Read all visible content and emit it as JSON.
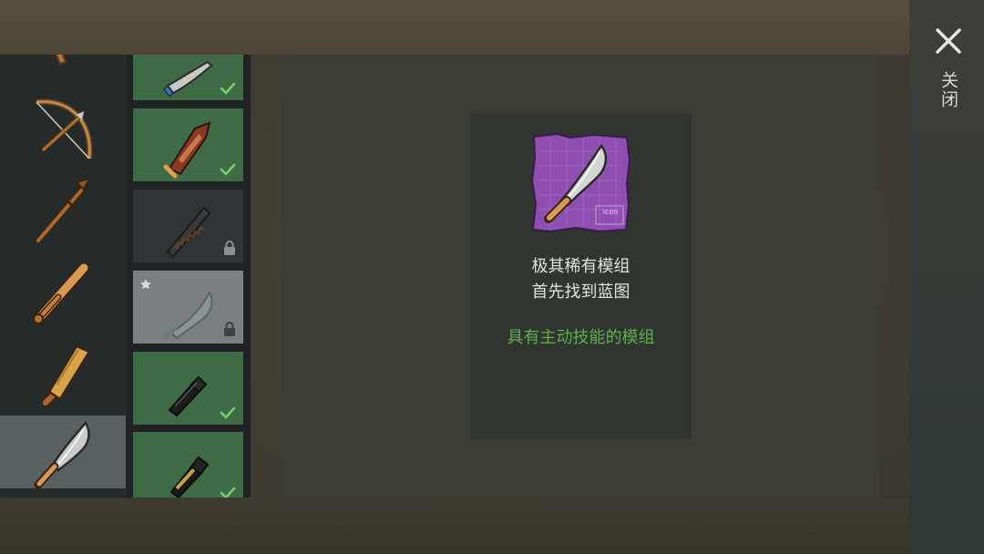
{
  "close": {
    "label": "关闭"
  },
  "weapons": [
    {
      "name": "crossbow-icon"
    },
    {
      "name": "pickaxe-icon"
    },
    {
      "name": "baseball-bat-icon"
    },
    {
      "name": "wooden-plank-icon"
    },
    {
      "name": "machete-icon",
      "selected": true
    }
  ],
  "mods": [
    {
      "state": "owned"
    },
    {
      "state": "owned"
    },
    {
      "state": "locked"
    },
    {
      "state": "locked-favorite"
    },
    {
      "state": "owned"
    },
    {
      "state": "owned"
    }
  ],
  "detail": {
    "blueprint_stamp": "icon",
    "line1": "极其稀有模组",
    "line2": "首先找到蓝图",
    "skill": "具有主动技能的模组"
  },
  "colors": {
    "owned": "#3e6b45",
    "accent_green": "#5fae4e",
    "blueprint": "#8e4fb0"
  }
}
